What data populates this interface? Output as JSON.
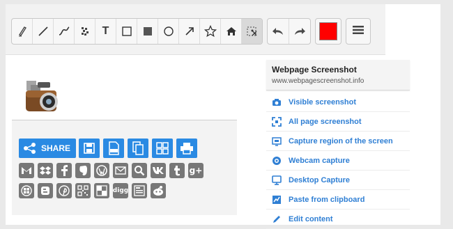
{
  "toolbar": {
    "tools": [
      "pencil-icon",
      "line-icon",
      "curve-icon",
      "blur-icon",
      "text-tool",
      "rectangle-outline-icon",
      "rectangle-filled-icon",
      "circle-icon",
      "arrow-icon",
      "star-icon",
      "home-icon",
      "crop-icon"
    ],
    "text_tool_label": "T",
    "accent_color": "#ff0000"
  },
  "share": {
    "label": "SHARE",
    "button_color": "#2a8ae3",
    "services_row1": [
      "gmail",
      "dropbox",
      "facebook",
      "evernote",
      "wordpress",
      "email",
      "search",
      "vk",
      "tumblr",
      "google-plus"
    ],
    "services_row2": [
      "windows",
      "blogger",
      "pinterest",
      "qr",
      "checker",
      "digg",
      "feed",
      "reddit"
    ],
    "digg_label": "digg",
    "gplus_label": "g+"
  },
  "sidebar": {
    "title": "Webpage Screenshot",
    "url": "www.webpagescreenshot.info",
    "items": [
      {
        "label": "Visible screenshot"
      },
      {
        "label": "All page screenshot"
      },
      {
        "label": "Capture region of the screen"
      },
      {
        "label": "Webcam capture"
      },
      {
        "label": "Desktop Capture"
      },
      {
        "label": "Paste from clipboard"
      },
      {
        "label": "Edit content"
      }
    ]
  }
}
